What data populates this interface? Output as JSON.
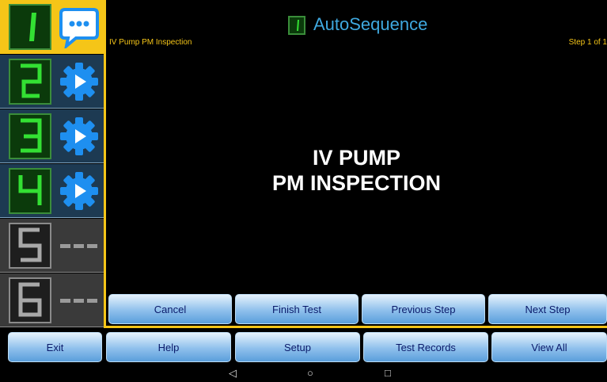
{
  "sidebar": {
    "slots": [
      {
        "digit": "1",
        "status": "selected",
        "icon": "chat-bubble-icon"
      },
      {
        "digit": "2",
        "status": "ready",
        "icon": "gear-play-icon"
      },
      {
        "digit": "3",
        "status": "ready",
        "icon": "gear-play-icon"
      },
      {
        "digit": "4",
        "status": "ready",
        "icon": "gear-play-icon"
      },
      {
        "digit": "5",
        "status": "empty",
        "icon": "dashes-icon"
      },
      {
        "digit": "6",
        "status": "empty",
        "icon": "dashes-icon"
      }
    ]
  },
  "header": {
    "title": "AutoSequence",
    "sequence_name": "IV Pump PM Inspection",
    "step_indicator": "Step 1 of 1"
  },
  "step": {
    "line1": "IV PUMP",
    "line2": "PM INSPECTION"
  },
  "step_controls": {
    "cancel": "Cancel",
    "finish": "Finish Test",
    "previous": "Previous Step",
    "next": "Next Step"
  },
  "bottom_toolbar": {
    "exit": "Exit",
    "help": "Help",
    "setup": "Setup",
    "records": "Test Records",
    "view_all": "View All"
  },
  "system_nav": {
    "back": "◁",
    "home": "○",
    "recents": "□"
  },
  "colors": {
    "accent_yellow": "#f5c518",
    "digit_green": "#33e033",
    "icon_blue": "#1e8ff0",
    "title_blue": "#3fa9e0"
  }
}
